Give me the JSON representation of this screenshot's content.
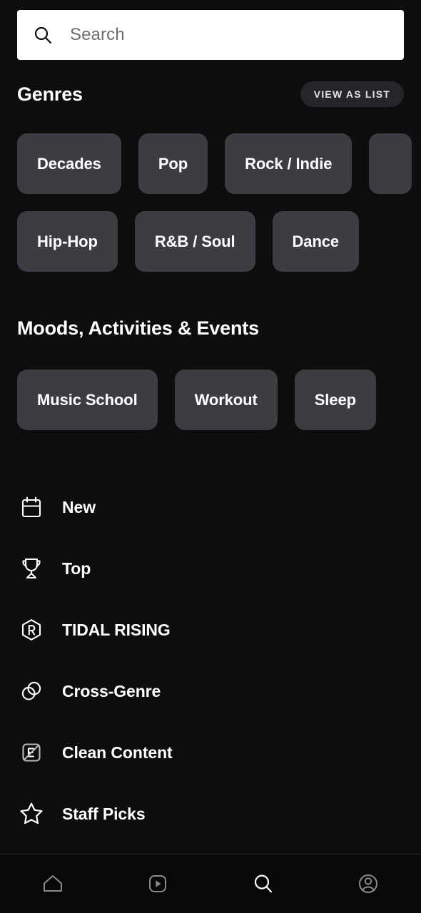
{
  "search": {
    "placeholder": "Search",
    "value": "",
    "icon": "search-icon"
  },
  "genres": {
    "title": "Genres",
    "view_as_list_label": "VIEW AS LIST",
    "rows": [
      [
        {
          "label": "Decades"
        },
        {
          "label": "Pop"
        },
        {
          "label": "Rock / Indie"
        },
        {
          "label": ""
        }
      ],
      [
        {
          "label": "Hip-Hop"
        },
        {
          "label": "R&B / Soul"
        },
        {
          "label": "Dance"
        }
      ]
    ]
  },
  "moods": {
    "title": "Moods, Activities & Events",
    "rows": [
      [
        {
          "label": "Music School"
        },
        {
          "label": "Workout"
        },
        {
          "label": "Sleep"
        }
      ]
    ]
  },
  "browse_list": [
    {
      "label": "New",
      "icon": "calendar-icon"
    },
    {
      "label": "Top",
      "icon": "trophy-icon"
    },
    {
      "label": "TIDAL RISING",
      "icon": "tidal-rising-icon"
    },
    {
      "label": "Cross-Genre",
      "icon": "overlapping-circles-icon"
    },
    {
      "label": "Clean Content",
      "icon": "no-explicit-icon"
    },
    {
      "label": "Staff Picks",
      "icon": "star-icon"
    }
  ],
  "bottom_nav": [
    {
      "name": "home",
      "icon": "home-icon",
      "active": false
    },
    {
      "name": "videos",
      "icon": "video-play-icon",
      "active": false
    },
    {
      "name": "search",
      "icon": "search-icon",
      "active": true
    },
    {
      "name": "profile",
      "icon": "account-circle-icon",
      "active": false
    }
  ],
  "colors": {
    "background": "#0d0d0d",
    "chip": "#3b3d43",
    "pill": "#25262a",
    "text": "#ffffff",
    "placeholder": "#6e6e6e",
    "nav_inactive": "#8a8a8e",
    "nav_active": "#ffffff",
    "search_field": "#ffffff"
  }
}
